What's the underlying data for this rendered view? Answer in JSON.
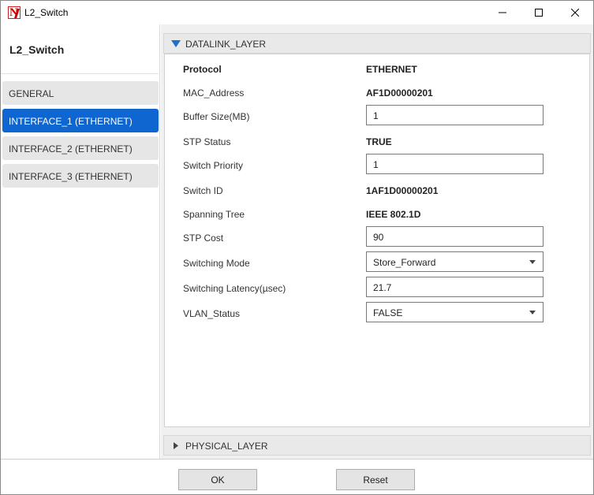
{
  "window": {
    "title": "L2_Switch",
    "icon": "app-logo-icon",
    "controls": [
      "minimize-icon",
      "maximize-icon",
      "close-icon"
    ]
  },
  "sidebar": {
    "device_name": "L2_Switch",
    "items": [
      {
        "label": "GENERAL",
        "active": false
      },
      {
        "label": "INTERFACE_1 (ETHERNET)",
        "active": true
      },
      {
        "label": "INTERFACE_2 (ETHERNET)",
        "active": false
      },
      {
        "label": "INTERFACE_3 (ETHERNET)",
        "active": false
      }
    ],
    "active_color": "#0f66d0"
  },
  "datalink": {
    "header": "DATALINK_LAYER",
    "expanded": true,
    "fields": {
      "protocol": {
        "label": "Protocol",
        "value": "ETHERNET"
      },
      "mac_address": {
        "label": "MAC_Address",
        "value": "AF1D00000201"
      },
      "buffer_size": {
        "label": "Buffer Size(MB)",
        "value": "1"
      },
      "stp_status": {
        "label": "STP Status",
        "value": "TRUE"
      },
      "switch_priority": {
        "label": "Switch Priority",
        "value": "1"
      },
      "switch_id": {
        "label": "Switch ID",
        "value": "1AF1D00000201"
      },
      "spanning_tree": {
        "label": "Spanning Tree",
        "value": "IEEE 802.1D"
      },
      "stp_cost": {
        "label": "STP Cost",
        "value": "90"
      },
      "switching_mode": {
        "label": "Switching Mode",
        "value": "Store_Forward"
      },
      "switching_latency": {
        "label": "Switching Latency(µsec)",
        "value": "21.7"
      },
      "vlan_status": {
        "label": "VLAN_Status",
        "value": "FALSE"
      }
    }
  },
  "physical": {
    "header": "PHYSICAL_LAYER",
    "expanded": false
  },
  "footer": {
    "ok_label": "OK",
    "reset_label": "Reset"
  }
}
